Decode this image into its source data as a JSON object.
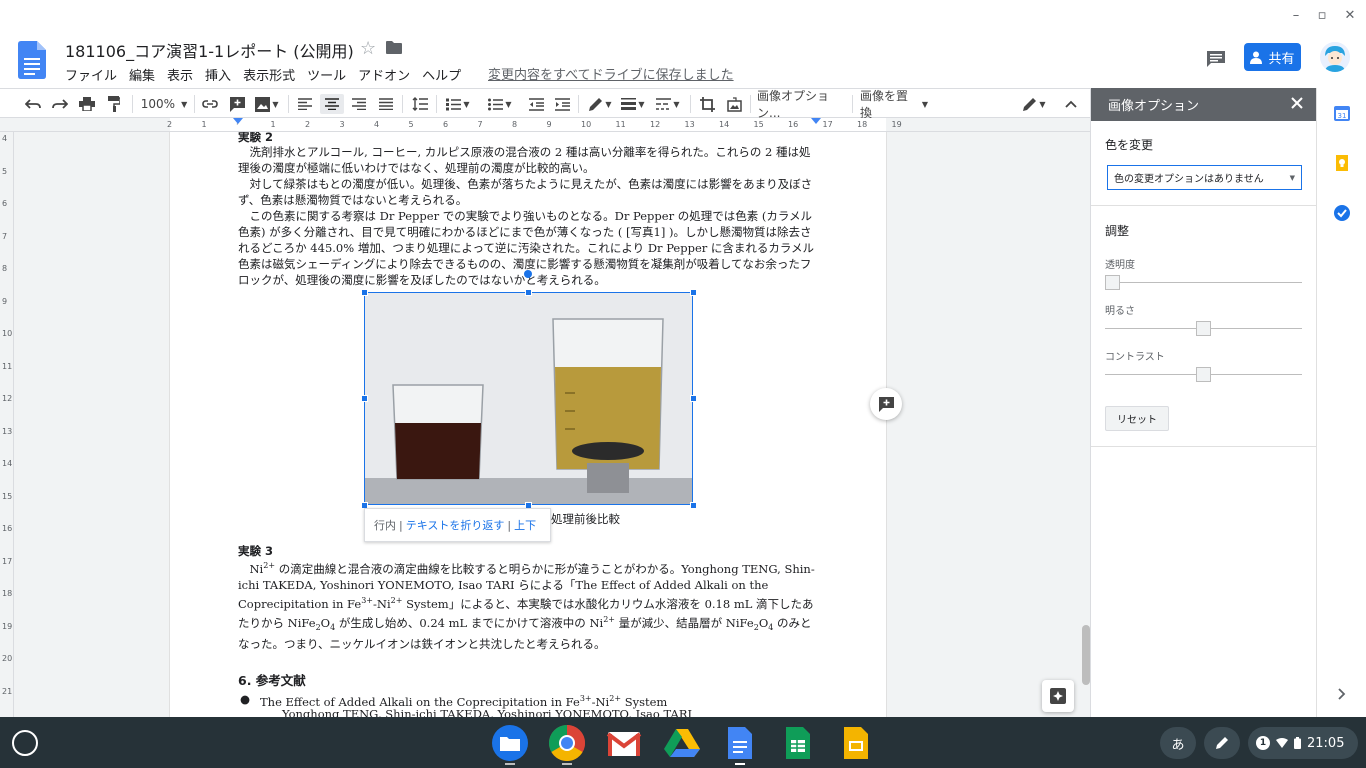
{
  "window": {
    "minimize": "–",
    "restore": "▫",
    "close": "✕"
  },
  "header": {
    "doc_title": "181106_コア演習1-1レポート (公開用)",
    "save_status": "変更内容をすべてドライブに保存しました",
    "share_label": "共有",
    "menus": [
      "ファイル",
      "編集",
      "表示",
      "挿入",
      "表示形式",
      "ツール",
      "アドオン",
      "ヘルプ"
    ]
  },
  "toolbar": {
    "zoom": "100%",
    "image_options_label": "画像オプション...",
    "replace_image_label": "画像を置換"
  },
  "ruler": {
    "h_ticks": [
      "2",
      "1",
      "",
      "1",
      "2",
      "3",
      "4",
      "5",
      "6",
      "7",
      "8",
      "9",
      "10",
      "11",
      "12",
      "13",
      "14",
      "15",
      "16",
      "17",
      "18",
      "19"
    ],
    "v_ticks": [
      "4",
      "5",
      "6",
      "7",
      "8",
      "9",
      "10",
      "11",
      "12",
      "13",
      "14",
      "15",
      "16",
      "17",
      "18",
      "19",
      "20",
      "21"
    ]
  },
  "document": {
    "exp2_heading": "実験 2",
    "exp2_p1": "　洗剤排水とアルコール, コーヒー, カルピス原液の混合液の 2 種は高い分離率を得られた。これらの 2 種は処理後の濁度が極端に低いわけではなく、処理前の濁度が比較的高い。",
    "exp2_p2": "　対して緑茶はもとの濁度が低い。処理後、色素が落ちたように見えたが、色素は濁度には影響をあまり及ぼさず、色素は懸濁物質ではないと考えられる。",
    "exp2_p3": "　この色素に関する考察は Dr Pepper での実験でより強いものとなる。Dr Pepper の処理では色素 (カラメル色素) が多く分離され、目で見て明確にわかるほどにまで色が薄くなった ( [写真1] )。しかし懸濁物質は除去されるどころか 445.0% 増加、つまり処理によって逆に汚染された。これにより Dr Pepper に含まれるカラメル色素は磁気シェーディングにより除去できるものの、濁度に影響する懸濁物質を凝集剤が吸着してなお余ったフロックが、処理後の濁度に影響を及ぼしたのではないかと考えられる。",
    "caption": "処理前後比較",
    "wrap_inline": "行内",
    "wrap_text": "テキストを折り返す",
    "wrap_break": "上下",
    "exp3_heading": "実験 3",
    "exp3_p_a": "　Ni",
    "exp3_p_b": " の滴定曲線と混合液の滴定曲線を比較すると明らかに形が違うことがわかる。Yonghong TENG, Shin-ichi TAKEDA, Yoshinori YONEMOTO, Isao TARI らによる「The Effect of Added Alkali on the Coprecipitation in Fe",
    "exp3_p_c": "-Ni",
    "exp3_p_d": " System」によると、本実験では水酸化カリウム水溶液を 0.18 mL 滴下したあたりから NiFe",
    "exp3_p_e": "O",
    "exp3_p_f": " が生成し始め、0.24 mL までにかけて溶液中の Ni",
    "exp3_p_g": " 量が減少、結晶層が NiFe",
    "exp3_p_h": "O",
    "exp3_p_i": " のみとなった。つまり、ニッケルイオンは鉄イオンと共沈したと考えられる。",
    "sup_2plus": "2+",
    "sup_3plus": "3+",
    "sub_2": "2",
    "sub_4": "4",
    "refs_heading": "6. 参考文献",
    "ref1_a": "The Effect of Added Alkali on the Coprecipitation in Fe",
    "ref1_b": "-Ni",
    "ref1_c": " System",
    "ref1_authors": "Yonghong TENG, Shin-ichi TAKEDA, Yoshinori YONEMOTO, Isao TARI"
  },
  "panel": {
    "title": "画像オプション",
    "recolor_title": "色を変更",
    "recolor_value": "色の変更オプションはありません",
    "adjust_title": "調整",
    "transparency_label": "透明度",
    "transparency_value": 0,
    "brightness_label": "明るさ",
    "brightness_value": 0,
    "contrast_label": "コントラスト",
    "contrast_value": 0,
    "reset_label": "リセット"
  },
  "shelf": {
    "ime": "あ",
    "notifications": "1",
    "time": "21:05"
  },
  "colors": {
    "accent": "#1a73e8",
    "panel_header": "#5f6368",
    "shelf": "#263238"
  }
}
